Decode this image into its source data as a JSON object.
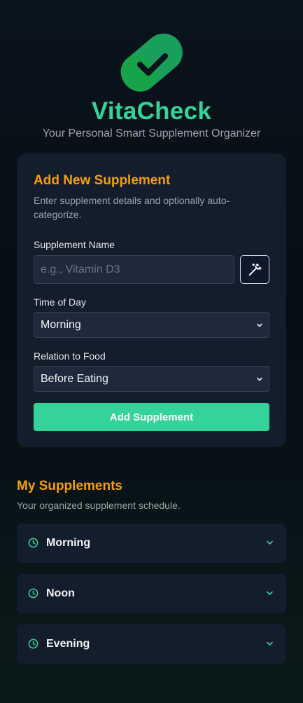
{
  "app": {
    "name": "VitaCheck",
    "tagline": "Your Personal Smart Supplement Organizer"
  },
  "colors": {
    "accent_green": "#34d399",
    "accent_orange": "#f59e0b",
    "card_bg": "#141d2b"
  },
  "form": {
    "title": "Add New Supplement",
    "description": "Enter supplement details and optionally auto-categorize.",
    "name_label": "Supplement Name",
    "name_placeholder": "e.g., Vitamin D3",
    "name_value": "",
    "auto_categorize_icon": "magic-wand-icon",
    "time_label": "Time of Day",
    "time_value": "Morning",
    "food_label": "Relation to Food",
    "food_value": "Before Eating",
    "submit_label": "Add Supplement"
  },
  "supplements": {
    "title": "My Supplements",
    "description": "Your organized supplement schedule.",
    "groups": [
      {
        "label": "Morning",
        "icon": "clock-icon"
      },
      {
        "label": "Noon",
        "icon": "clock-icon"
      },
      {
        "label": "Evening",
        "icon": "clock-icon"
      }
    ]
  }
}
